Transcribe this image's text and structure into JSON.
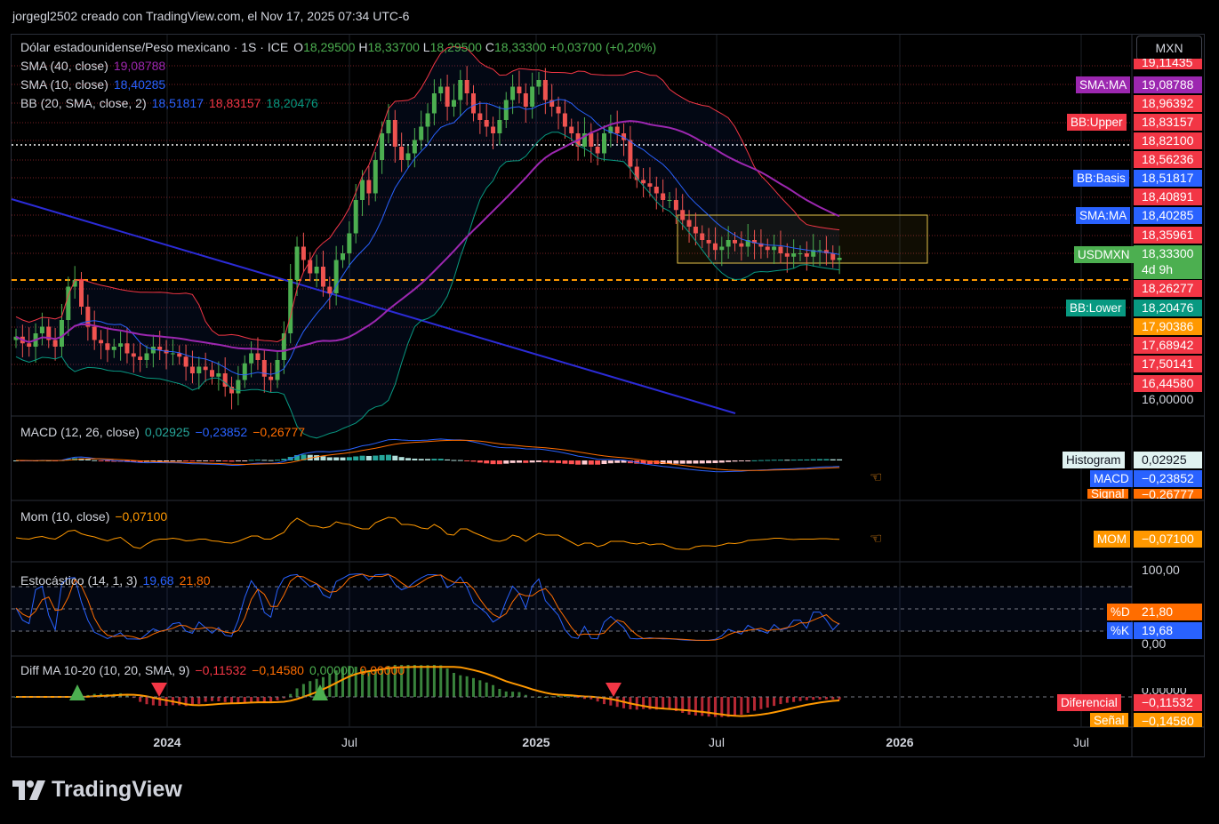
{
  "header": {
    "title": "jorgegl2502 creado con TradingView.com, el Nov 17, 2025 07:34 UTC-6"
  },
  "currency": "MXN",
  "brand": {
    "name": "TradingView"
  },
  "legend": {
    "symbol": "Dólar estadounidense/Peso mexicano · 1S · ICE",
    "o_label": "O",
    "o_value": "18,29500",
    "h_label": "H",
    "h_value": "18,33700",
    "l_label": "L",
    "l_value": "18,29500",
    "c_label": "C",
    "c_value": "18,33300",
    "change": "+0,03700 (+0,20%)",
    "sma40_label": "SMA (40, close)",
    "sma40_value": "19,08788",
    "sma10_label": "SMA (10, close)",
    "sma10_value": "18,40285",
    "bb_label": "BB (20, SMA, close, 2)",
    "bb_basis": "18,51817",
    "bb_upper": "18,83157",
    "bb_lower": "18,20476"
  },
  "price_axis": {
    "top_partial": "19,11435",
    "sma_ma_tag": "SMA:MA",
    "sma_ma_value": "19,08788",
    "v1": "18,96392",
    "bb_upper_tag": "BB:Upper",
    "bb_upper_value": "18,83157",
    "v2": "18,82100",
    "v3": "18,56236",
    "bb_basis_tag": "BB:Basis",
    "bb_basis_value": "18,51817",
    "v4": "18,40891",
    "sma10_tag": "SMA:MA",
    "sma10_value": "18,40285",
    "v5": "18,35961",
    "symbol_tag": "USDMXN",
    "last_value": "18,33300",
    "countdown": "4d 9h",
    "v6": "18,26277",
    "bb_lower_tag": "BB:Lower",
    "bb_lower_value": "18,20476",
    "v7": "17,90386",
    "v8": "17,68942",
    "v9": "17,50141",
    "v10": "16,44580",
    "v11": "16,00000"
  },
  "macd": {
    "label": "MACD (12, 26, close)",
    "hist": "0,02925",
    "macd": "−0,23852",
    "signal": "−0,26777",
    "tag_hist": "Histogram",
    "tag_macd": "MACD",
    "tag_signal": "Signal"
  },
  "mom": {
    "label": "Mom (10, close)",
    "value": "−0,07100",
    "tag": "MOM"
  },
  "stoch": {
    "label": "Estocástico (14, 1, 3)",
    "k": "19,68",
    "d": "21,80",
    "tag_d": "%D",
    "tag_k": "%K",
    "axis_top": "100,00",
    "axis_bottom": "0,00"
  },
  "diff": {
    "label": "Diff MA 10-20 (10, 20, SMA, 9)",
    "v1": "−0,11532",
    "v2": "−0,14580",
    "v3": "0,00000",
    "v4": "0,00000",
    "tag_diff": "Diferencial",
    "tag_sig": "Señal",
    "axis_partial": "0,00000"
  },
  "x_axis": {
    "l2024": "2024",
    "jul1": "Jul",
    "l2025": "2025",
    "jul2": "Jul",
    "l2026": "2026",
    "jul3": "Jul"
  },
  "colors": {
    "up": "#26a69a",
    "down": "#ef5350",
    "green": "#4caf50",
    "red": "#f23645",
    "bb_upper": "#f23645",
    "bb_basis": "#2962ff",
    "bb_lower": "#089981",
    "sma40": "#9c27b0",
    "macd": "#2962ff",
    "signal": "#ff6d00",
    "mom": "#ff9800",
    "stoch_k": "#2962ff",
    "stoch_d": "#ff6d00"
  },
  "chart_data": {
    "type": "candlestick",
    "symbol": "USDMXN",
    "x_ticks": [
      "2024",
      "Jul",
      "2025",
      "Jul",
      "2026",
      "Jul"
    ],
    "last": {
      "open": 18.295,
      "high": 18.337,
      "low": 18.295,
      "close": 18.333
    },
    "closes": [
      17.15,
      17.05,
      17.0,
      17.2,
      17.3,
      17.1,
      17.0,
      17.4,
      17.9,
      18.0,
      17.6,
      17.3,
      17.1,
      17.05,
      16.95,
      17.0,
      17.05,
      16.9,
      16.85,
      16.8,
      16.9,
      17.0,
      16.95,
      16.9,
      16.9,
      16.85,
      16.7,
      16.6,
      16.7,
      16.65,
      16.55,
      16.6,
      16.4,
      16.3,
      16.5,
      16.75,
      16.9,
      16.8,
      16.55,
      16.5,
      16.8,
      17.2,
      18.0,
      18.5,
      18.3,
      18.1,
      18.2,
      17.9,
      17.8,
      18.3,
      18.4,
      18.7,
      19.2,
      19.5,
      19.3,
      19.8,
      20.2,
      20.4,
      20.0,
      19.8,
      19.9,
      20.1,
      20.3,
      20.5,
      20.8,
      20.9,
      20.6,
      20.7,
      21.0,
      20.8,
      20.5,
      20.4,
      20.3,
      20.2,
      20.4,
      20.7,
      20.9,
      20.8,
      20.6,
      20.9,
      21.0,
      20.7,
      20.6,
      20.5,
      20.3,
      20.2,
      20.0,
      20.2,
      20.0,
      19.9,
      20.2,
      20.3,
      20.2,
      20.1,
      19.7,
      19.5,
      19.45,
      19.4,
      19.3,
      19.2,
      19.2,
      19.05,
      18.9,
      18.8,
      18.7,
      18.6,
      18.55,
      18.45,
      18.5,
      18.6,
      18.55,
      18.5,
      18.6,
      18.55,
      18.5,
      18.45,
      18.5,
      18.4,
      18.35,
      18.4,
      18.4,
      18.35,
      18.45,
      18.45,
      18.4,
      18.3,
      18.333
    ],
    "ylim": [
      16.0,
      21.6
    ],
    "bb_upper_last": 18.83157,
    "bb_basis_last": 18.51817,
    "bb_lower_last": 18.20476,
    "sma40_last": 19.08788,
    "sma10_last": 18.40285,
    "panes": [
      "price",
      "macd",
      "mom",
      "stochastic",
      "diff_ma"
    ]
  }
}
